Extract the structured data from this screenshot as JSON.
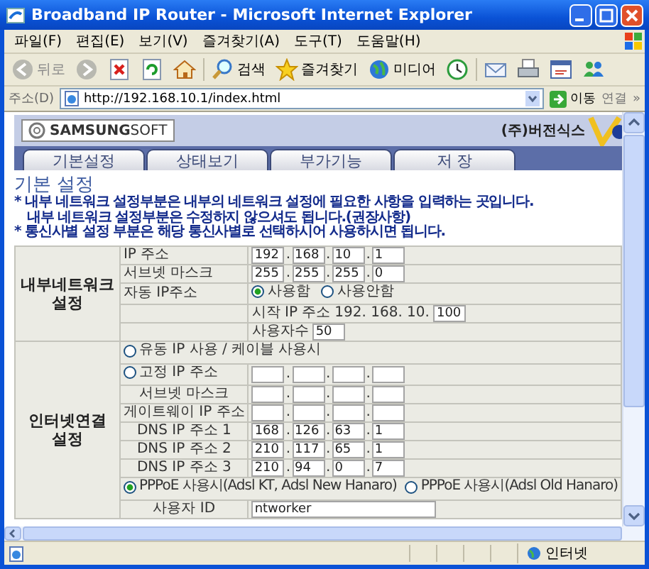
{
  "window": {
    "title": "Broadband IP Router - Microsoft Internet Explorer"
  },
  "menu_bar": [
    "파일(F)",
    "편집(E)",
    "보기(V)",
    "즐겨찾기(A)",
    "도구(T)",
    "도움말(H)"
  ],
  "toolbar": [
    {
      "kind": "back",
      "label": "뒤로"
    },
    {
      "kind": "forward"
    },
    {
      "kind": "stop"
    },
    {
      "kind": "refresh"
    },
    {
      "kind": "home"
    },
    {
      "kind": "search",
      "label": "검색"
    },
    {
      "kind": "favorites",
      "label": "즐겨찾기"
    },
    {
      "kind": "media",
      "label": "미디어"
    },
    {
      "kind": "history"
    },
    {
      "kind": "mail"
    },
    {
      "kind": "print"
    },
    {
      "kind": "edit"
    },
    {
      "kind": "messenger"
    }
  ],
  "address_bar": {
    "label": "주소(D)",
    "url": "http://192.168.10.1/index.html",
    "go": "이동",
    "links": "연결",
    "more": "»"
  },
  "page": {
    "logo": "**SAMSUNG**SOFT",
    "vendor": "(주)버전식스",
    "tabs": [
      "기본설정",
      "상태보기",
      "부가기능",
      "저 장"
    ],
    "heading": "기본 설정",
    "octet_separator": ".",
    "notes": [
      "* 내부 네트워크 설정부분은 내부의 네트워크 설정에 필요한 사항을 입력하는 곳입니다.",
      "내부 네트워크 설정부분은 수정하지 않으셔도 됩니다.(권장사항)",
      "* 통신사별 설정 부분은 해당 통신사별로 선택하시어 사용하시면 됩니다."
    ],
    "sections": [
      {
        "label": "내부네트워크 설정",
        "rows": [
          {
            "kind": "ip",
            "label": "IP 주소",
            "octets": [
              "192",
              "168",
              "10",
              "1"
            ]
          },
          {
            "kind": "ip",
            "label": "서브넷 마스크",
            "octets": [
              "255",
              "255",
              "255",
              "0"
            ]
          },
          {
            "kind": "radio_group",
            "label": "자동 IP주소",
            "options": [
              {
                "label": "사용함",
                "selected": true
              },
              {
                "label": "사용안함",
                "selected": false
              }
            ]
          },
          {
            "kind": "start_ip",
            "label": "시작 IP 주소",
            "prefix": "192.  168.  10.",
            "value": "100"
          },
          {
            "kind": "count",
            "label": "사용자수",
            "value": "50"
          }
        ]
      },
      {
        "label": "인터넷연결 설정",
        "rows": [
          {
            "kind": "radio_row",
            "option": {
              "label": "유동 IP 사용 / 케이블 사용시",
              "selected": false
            }
          },
          {
            "kind": "radio_ip",
            "option": {
              "label": "고정 IP 주소",
              "selected": false
            }
          },
          {
            "kind": "ip",
            "label": "서브넷 마스크"
          },
          {
            "kind": "ip",
            "label": "게이트웨이 IP 주소"
          },
          {
            "kind": "ip",
            "label": "DNS IP 주소 1",
            "octets": [
              "168",
              "126",
              "63",
              "1"
            ]
          },
          {
            "kind": "ip",
            "label": "DNS IP 주소 2",
            "octets": [
              "210",
              "117",
              "65",
              "1"
            ]
          },
          {
            "kind": "ip",
            "label": "DNS IP 주소 3",
            "octets": [
              "210",
              "94",
              "0",
              "7"
            ]
          },
          {
            "kind": "radio_pair",
            "options": [
              {
                "label": "PPPoE 사용시(Adsl KT, Adsl New Hanaro)",
                "selected": true
              },
              {
                "label": "PPPoE 사용시(Adsl Old Hanaro)",
                "selected": false
              }
            ]
          },
          {
            "kind": "text",
            "label": "사용자 ID",
            "value": "ntworker"
          }
        ]
      }
    ]
  },
  "status_bar": {
    "zone": "인터넷"
  }
}
